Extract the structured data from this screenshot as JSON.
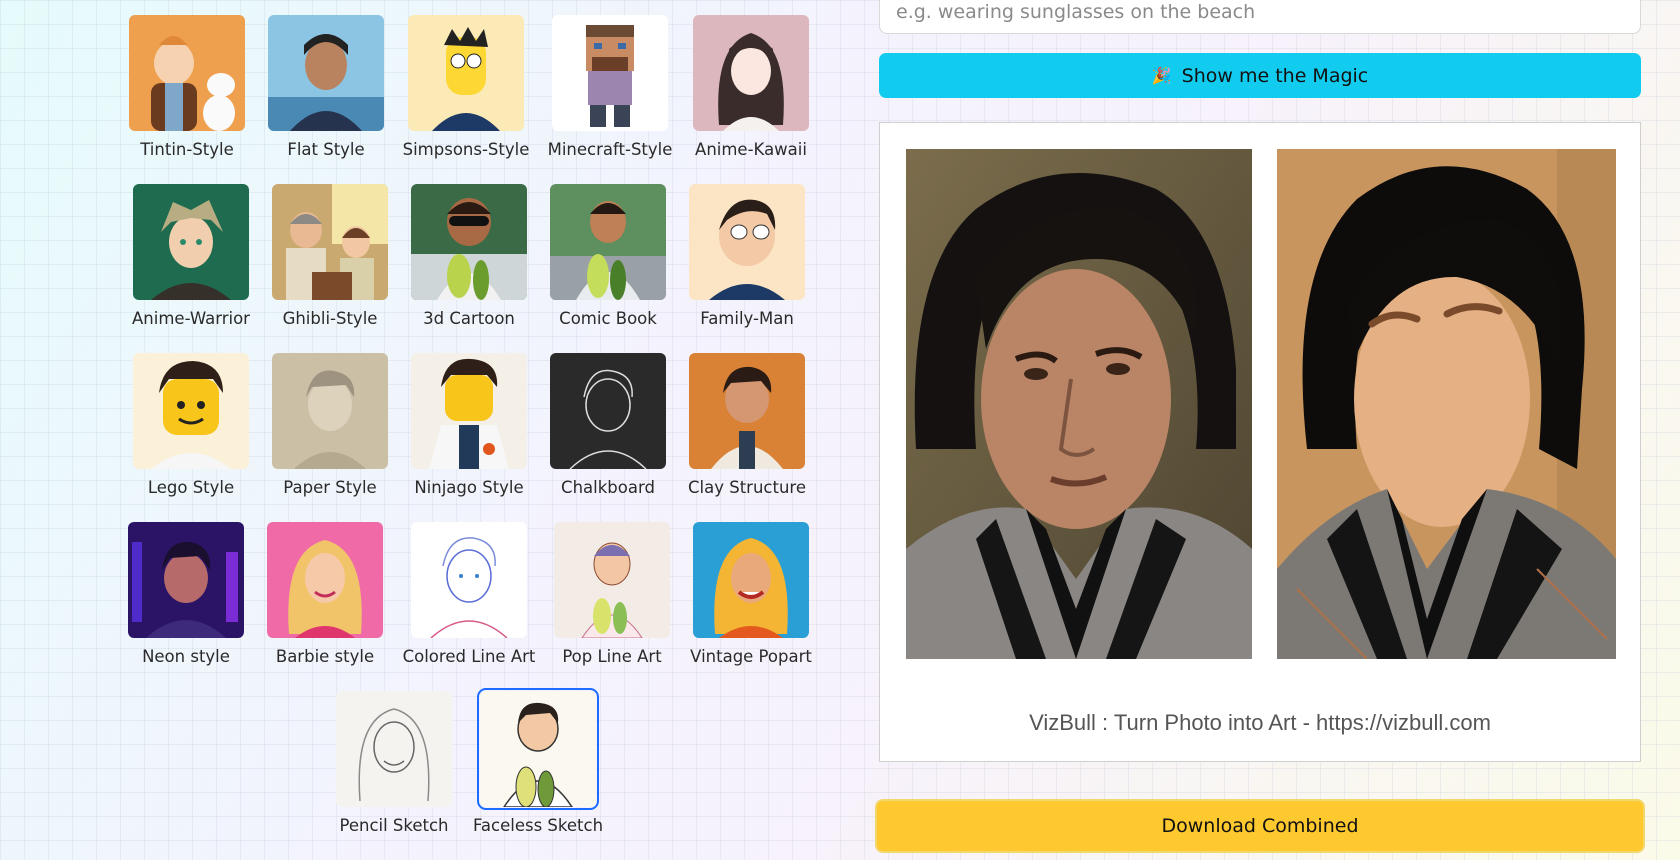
{
  "styles": [
    {
      "label": "Tintin-Style"
    },
    {
      "label": "Flat Style"
    },
    {
      "label": "Simpsons-Style"
    },
    {
      "label": "Minecraft-Style"
    },
    {
      "label": "Anime-Kawaii"
    },
    {
      "label": "Anime-Warrior"
    },
    {
      "label": "Ghibli-Style"
    },
    {
      "label": "3d Cartoon"
    },
    {
      "label": "Comic Book"
    },
    {
      "label": "Family-Man"
    },
    {
      "label": "Lego Style"
    },
    {
      "label": "Paper Style"
    },
    {
      "label": "Ninjago Style"
    },
    {
      "label": "Chalkboard"
    },
    {
      "label": "Clay Structure"
    },
    {
      "label": "Neon style"
    },
    {
      "label": "Barbie style"
    },
    {
      "label": "Colored Line Art"
    },
    {
      "label": "Pop Line Art"
    },
    {
      "label": "Vintage Popart"
    },
    {
      "label": "Pencil Sketch"
    },
    {
      "label": "Faceless Sketch",
      "selected": true
    }
  ],
  "prompt": {
    "placeholder": "e.g. wearing sunglasses on the beach",
    "value": ""
  },
  "magic_button": {
    "icon": "party-popper-icon",
    "label": "Show me the Magic"
  },
  "result": {
    "watermark": "VizBull : Turn Photo into Art - https://vizbull.com"
  },
  "download_button": {
    "label": "Download Combined"
  },
  "colors": {
    "magic_button": "#12ccf0",
    "download_button": "#fdc92f",
    "selected_outline": "#1e6bff"
  }
}
